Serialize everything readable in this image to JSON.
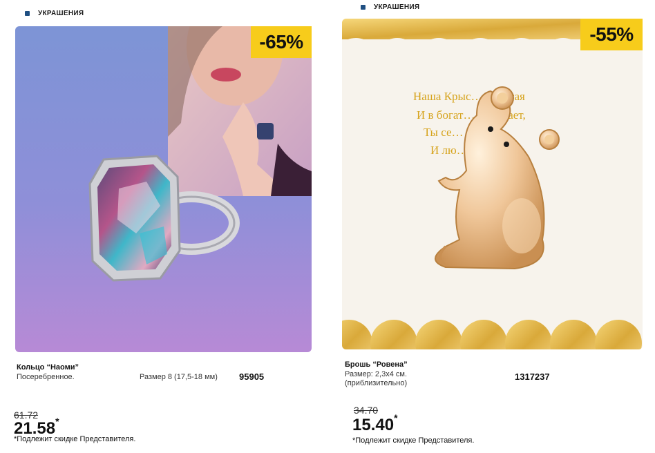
{
  "left": {
    "section_label": "УКРАШЕНИЯ",
    "discount": "-65%",
    "product_name": "Кольцо “Наоми”",
    "description": "Посеребренное.",
    "size": "Размер 8 (17,5-18 мм)",
    "code": "95905",
    "old_price": "61.72",
    "new_price": "21.58",
    "asterisk": "*",
    "note": "*Подлежит скидке Представителя."
  },
  "right": {
    "section_label": "УКРАШЕНИЯ",
    "discount": "-55%",
    "product_name": "Брошь “Ровена”",
    "size_line1": "Размер: 2,3х4 см.",
    "size_line2": "(приблизительно)",
    "code": "1317237",
    "old_price": "34.70",
    "new_price": "15.40",
    "asterisk": "*",
    "note": "*Подлежит скидке Представителя.",
    "card_text": [
      "Наша Крыс… простая",
      "И в богат… помогает,",
      "Ты се…",
      "И лю…"
    ]
  },
  "colors": {
    "badge": "#f7cc1b",
    "tag_dot": "#1f4f82"
  }
}
